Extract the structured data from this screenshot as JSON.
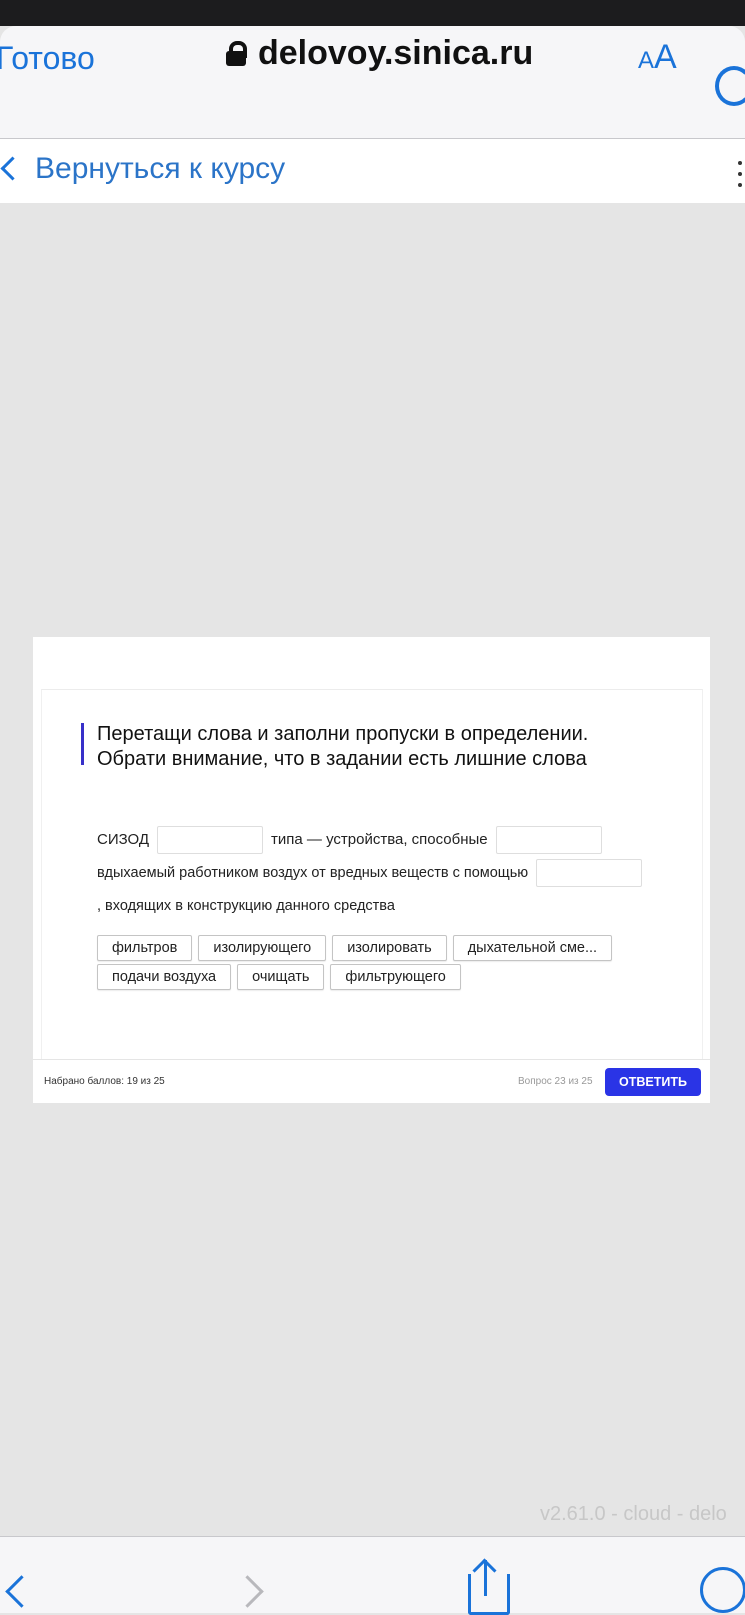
{
  "browser": {
    "done_label": "Готово",
    "url": "delovoy.sinica.ru",
    "text_size_small": "A",
    "text_size_large": "A"
  },
  "nav": {
    "back_label": "Вернуться к курсу"
  },
  "question": {
    "title_line1": "Перетащи слова и заполни пропуски в определении.",
    "title_line2": "Обрати внимание, что в задании есть лишние слова",
    "sentence": {
      "part1": "СИЗОД",
      "part2": "типа — устройства, способные",
      "part3": "вдыхаемый работником воздух от вредных веществ с помощью",
      "part4": ", входящих в конструкцию данного средства"
    },
    "chips": [
      "фильтров",
      "изолирующего",
      "изолировать",
      "дыхательной сме...",
      "подачи воздуха",
      "очищать",
      "фильтрующего"
    ]
  },
  "footer": {
    "score": "Набрано баллов: 19 из 25",
    "question_number": "Вопрос 23 из 25",
    "answer_button": "ОТВЕТИТЬ"
  },
  "version": "v2.61.0 - cloud - delo",
  "colors": {
    "accent": "#1a73d9",
    "answer_button": "#2a34e6",
    "question_bar": "#3730c9"
  }
}
